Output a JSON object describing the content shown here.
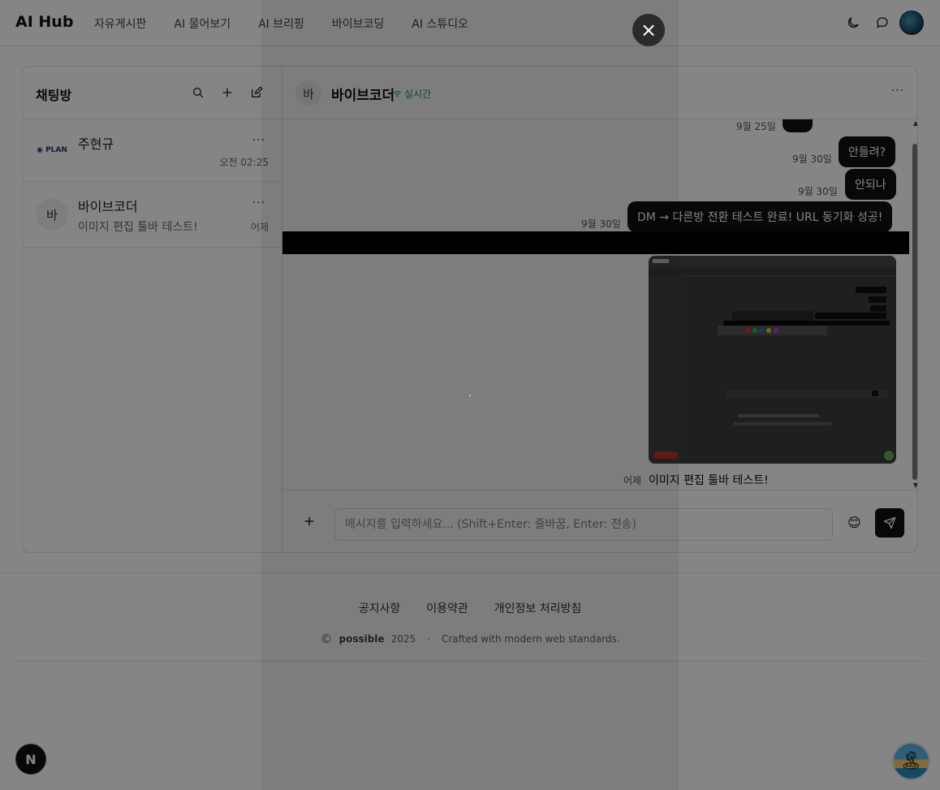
{
  "header": {
    "logo": "AI Hub",
    "nav": [
      "자유게시판",
      "AI 물어보기",
      "AI 브리핑",
      "바이브코딩",
      "AI 스튜디오"
    ],
    "icons": [
      "moon-icon",
      "chat-bubble-icon",
      "user-avatar"
    ]
  },
  "sidebar": {
    "title": "채팅방",
    "rooms": [
      {
        "name": "주현규",
        "avatar": "PLAN",
        "preview": "",
        "time": "오전 02:25"
      },
      {
        "name": "바이브코더",
        "avatar": "바",
        "preview": "이미지 편집 툴바 테스트!",
        "time": "어제"
      }
    ]
  },
  "chat": {
    "avatar": "바",
    "title": "바이브코더",
    "status": "실시간",
    "messages": [
      {
        "time": "9월 25일",
        "text": "...",
        "partial": true
      },
      {
        "time": "9월 30일",
        "text": "안들려?"
      },
      {
        "time": "9월 30일",
        "text": "안되나"
      },
      {
        "time": "9월 30일",
        "text": "DM → 다른방 전환 테스트 완료! URL 동기화 성공!"
      }
    ],
    "image_message": {
      "time": "어제",
      "caption": "이미지 편집 툴바 테스트!"
    }
  },
  "composer": {
    "placeholder": "메시지를 입력하세요... (Shift+Enter: 줄바꿈, Enter: 전송)",
    "emoji": "😊"
  },
  "footer": {
    "links": [
      "공지사항",
      "이용약관",
      "개인정보 처리방침"
    ],
    "copyright_symbol": "©",
    "brand": "possible",
    "year": "2025",
    "separator": "·",
    "tagline": "Crafted with modern web standards."
  },
  "badges": {
    "next": "N",
    "island": "🏝"
  },
  "overlay": {
    "close": "×"
  }
}
